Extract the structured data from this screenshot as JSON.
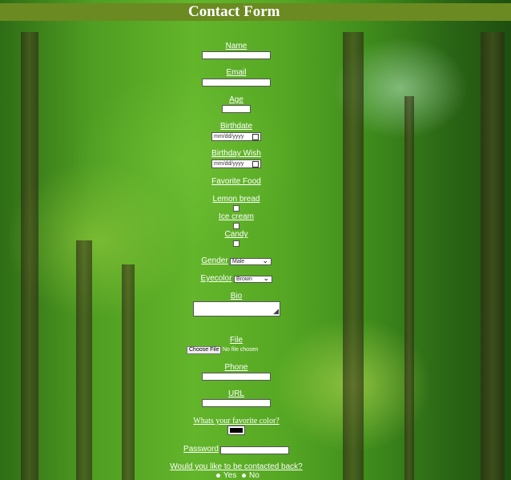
{
  "page": {
    "title": "Contact Form"
  },
  "fields": {
    "name": {
      "label": "Name",
      "value": ""
    },
    "email": {
      "label": "Email",
      "value": ""
    },
    "age": {
      "label": "Age",
      "value": ""
    },
    "birthdate": {
      "label": "Birthdate",
      "placeholder": "mm/dd/yyyy"
    },
    "birthday_wish": {
      "label": "Birthday Wish",
      "placeholder": "mm/dd/yyyy"
    },
    "favorite_food": {
      "label": "Favorite Food",
      "options": [
        {
          "label": "Lemon bread",
          "checked": false
        },
        {
          "label": "Ice cream",
          "checked": false
        },
        {
          "label": "Candy",
          "checked": false
        }
      ]
    },
    "gender": {
      "label": "Gender",
      "selected": "Male"
    },
    "eyecolor": {
      "label": "Eyecolor",
      "selected": "Brown"
    },
    "bio": {
      "label": "Bio",
      "value": ""
    },
    "file": {
      "label": "File",
      "button": "Choose File",
      "status": "No file chosen"
    },
    "phone": {
      "label": "Phone",
      "value": ""
    },
    "url": {
      "label": "URL",
      "value": ""
    },
    "color": {
      "label": "Whats your favorite color?",
      "value": "#000000"
    },
    "password": {
      "label": "Password",
      "value": ""
    },
    "contact_back": {
      "label": "Would you like to be contacted back?",
      "options": [
        "Yes",
        "No"
      ]
    }
  },
  "colors": {
    "header_bg": "#6b8a22",
    "text": "#ffffff"
  },
  "icons": {
    "date": "calendar-icon",
    "select": "chevron-down-icon",
    "textarea": "resize-grip-icon"
  }
}
